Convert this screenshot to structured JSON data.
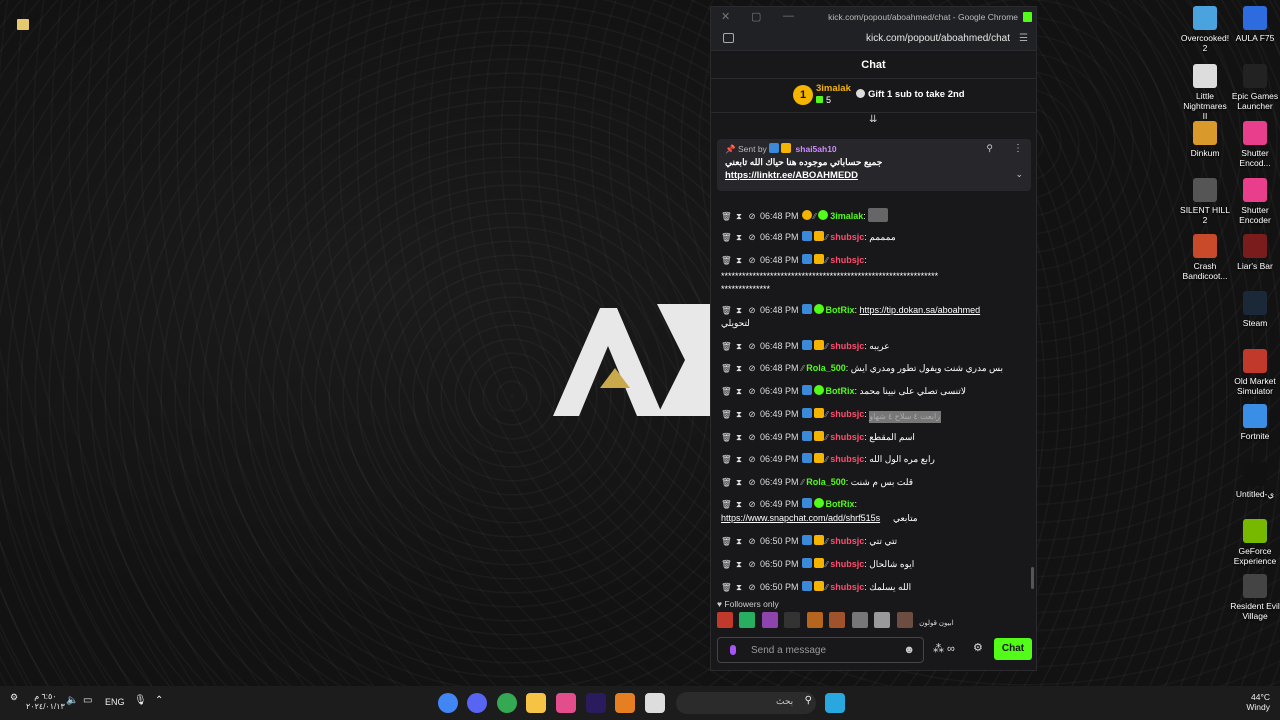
{
  "browser": {
    "title": "kick.com/popout/aboahmed/chat - Google Chrome",
    "url": "kick.com/popout/aboahmed/chat"
  },
  "chat": {
    "header": "Chat",
    "leaderboard": {
      "rank": "1",
      "name": "3imalak",
      "count": "5",
      "gift_text": "Gift 1 sub to take 2nd"
    },
    "pinned": {
      "sent_by": "Sent by",
      "user": "shai5ah10",
      "message": "جميع حساباتي موجوده هنا حياك الله تابعني",
      "link": "https://linktr.ee/ABOAHMEDD"
    },
    "messages": [
      {
        "time": "06:48 PM",
        "user": "3imalak",
        "color": "#53fc18",
        "text": ""
      },
      {
        "time": "06:48 PM",
        "user": "shubsjc",
        "color": "#ff4d6d",
        "text": "ممممم"
      },
      {
        "time": "06:48 PM",
        "user": "shubsjc",
        "color": "#ff4d6d",
        "text": ""
      },
      {
        "time": "06:48 PM",
        "user": "BotRix",
        "color": "#53fc18",
        "text": ""
      },
      {
        "time": "06:48 PM",
        "user": "shubsjc",
        "color": "#ff4d6d",
        "text": "عريبه"
      },
      {
        "time": "06:48 PM",
        "user": "Rola_500",
        "color": "#53fc18",
        "text": "بس مدري شنت ويفول تطور ومدري ايش"
      },
      {
        "time": "06:49 PM",
        "user": "BotRix",
        "color": "#53fc18",
        "text": "لاتنسى تصلي على نبينا محمد"
      },
      {
        "time": "06:49 PM",
        "user": "shubsjc",
        "color": "#ff4d6d",
        "text": ""
      },
      {
        "time": "06:49 PM",
        "user": "shubsjc",
        "color": "#ff4d6d",
        "text": "اسم المقطع"
      },
      {
        "time": "06:49 PM",
        "user": "shubsjc",
        "color": "#ff4d6d",
        "text": "رابع مره الول الله"
      },
      {
        "time": "06:49 PM",
        "user": "Rola_500",
        "color": "#53fc18",
        "text": "قلت بس م شنت"
      },
      {
        "time": "06:49 PM",
        "user": "BotRix",
        "color": "#53fc18",
        "text": ""
      },
      {
        "time": "06:50 PM",
        "user": "shubsjc",
        "color": "#ff4d6d",
        "text": "تتي تتي"
      },
      {
        "time": "06:50 PM",
        "user": "shubsjc",
        "color": "#ff4d6d",
        "text": "ايوه شالحال"
      },
      {
        "time": "06:50 PM",
        "user": "shubsjc",
        "color": "#ff4d6d",
        "text": "الله يسلمك"
      }
    ],
    "wrapped": {
      "stars_line1": "**************************************************************",
      "stars_line2": "**************",
      "botrix_link": "https://tip.dokan.sa/aboahmed",
      "botrix_wrap": "لتحويلي",
      "blurred": "رابعت ٤ سلاح ٤ شهاو",
      "snap_link": "https://www.snapchat.com/add/shrf515s",
      "snap_wrap": "متابعي"
    },
    "followers_only": "Followers only",
    "emote_label": "ابيون قولون",
    "input_placeholder": "Send a message",
    "chat_button": "Chat"
  },
  "desktop_icons": [
    {
      "label": "Overcooked! 2",
      "color": "#4aa3df"
    },
    {
      "label": "AULA F75",
      "color": "#2d6cdf"
    },
    {
      "label": "Little Nightmares II",
      "color": "#ddd"
    },
    {
      "label": "Epic Games Launcher",
      "color": "#222"
    },
    {
      "label": "Dinkum",
      "color": "#d99a2b"
    },
    {
      "label": "Shutter Encod...",
      "color": "#e83e8c"
    },
    {
      "label": "SILENT HILL 2",
      "color": "#555"
    },
    {
      "label": "Shutter Encoder",
      "color": "#e83e8c"
    },
    {
      "label": "Crash Bandicoot...",
      "color": "#c94a2b"
    },
    {
      "label": "Liar's Bar",
      "color": "#7a1c1c"
    },
    {
      "label": "Steam",
      "color": "#1b2838"
    },
    {
      "label": "Old Market Simulator",
      "color": "#c0392b"
    },
    {
      "label": "Fortnite",
      "color": "#3a8ee6"
    },
    {
      "label": "Untitled-ي",
      "color": "#111"
    },
    {
      "label": "GeForce Experience",
      "color": "#76b900"
    },
    {
      "label": "Resident Evil Village",
      "color": "#444"
    }
  ],
  "taskbar": {
    "clock_time": "٦:٥٠ م",
    "clock_date": "٢٠٢٤/٠١/١٣",
    "language": "ENG",
    "search_placeholder": "بحث",
    "temperature": "44°C",
    "weather": "Windy"
  }
}
